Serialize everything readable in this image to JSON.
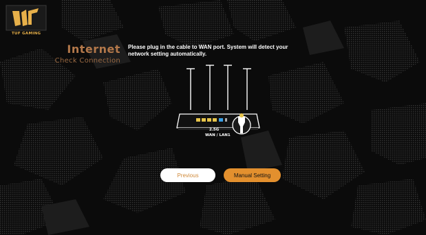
{
  "brand": {
    "logo_text": "TUF GAMING",
    "accent_color": "#e3902e"
  },
  "page": {
    "title": "Internet",
    "subtitle": "Check Connection",
    "instructions": "Please plug in the cable to WAN port. System will detect your network setting automatically."
  },
  "router_illustration": {
    "port_label_1": "2.5G",
    "port_label_2": "WAN / LAN1"
  },
  "buttons": {
    "previous": "Previous",
    "manual_setting": "Manual Setting"
  }
}
